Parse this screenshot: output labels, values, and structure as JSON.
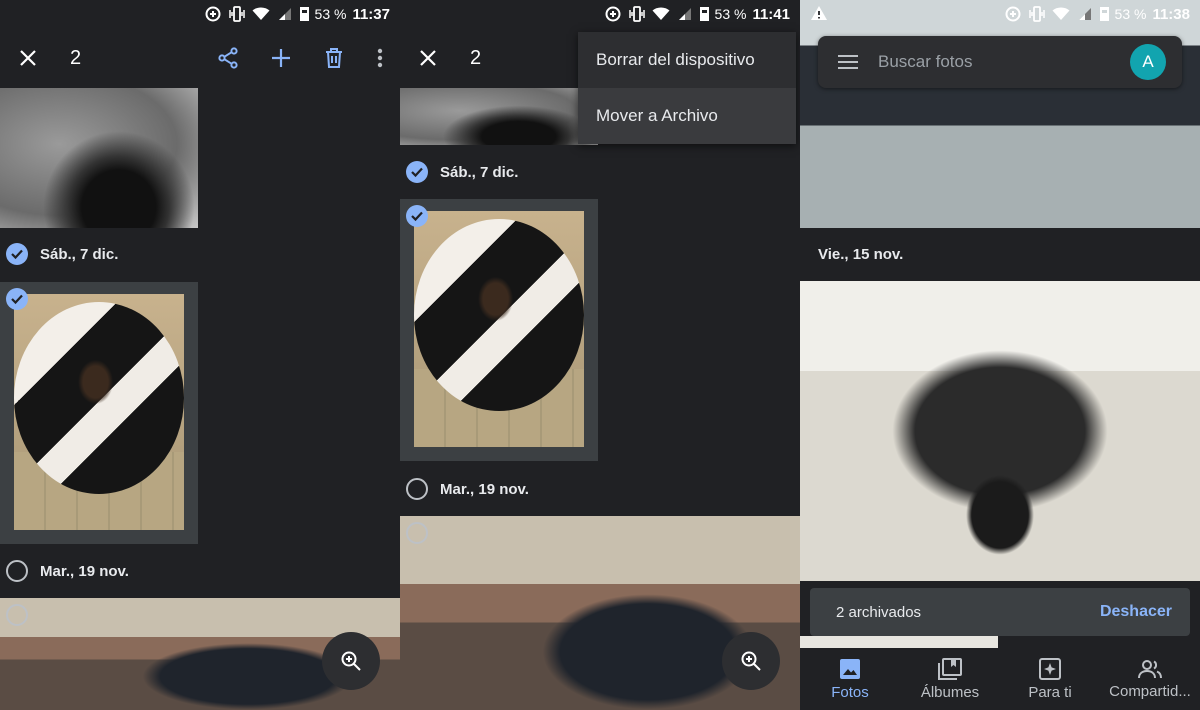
{
  "colors": {
    "background": "#202124",
    "accent": "#8ab4f8",
    "surface": "#2d2e31",
    "avatar": "#12a4af"
  },
  "panel1": {
    "status": {
      "battery": "53 %",
      "time": "11:37"
    },
    "appbar": {
      "selected_count": "2"
    },
    "groups": [
      {
        "date": "Sáb., 7 dic.",
        "checked": true
      },
      {
        "date": "Mar., 19 nov.",
        "checked": false
      }
    ]
  },
  "panel2": {
    "status": {
      "battery": "53 %",
      "time": "11:41"
    },
    "appbar": {
      "selected_count": "2"
    },
    "menu": {
      "items": [
        "Borrar del dispositivo",
        "Mover a Archivo"
      ]
    },
    "groups": [
      {
        "date": "Sáb., 7 dic.",
        "checked": true
      },
      {
        "date": "Mar., 19 nov.",
        "checked": false
      }
    ]
  },
  "panel3": {
    "status": {
      "battery": "53 %",
      "time": "11:38"
    },
    "search": {
      "placeholder": "Buscar fotos",
      "avatar_initial": "A"
    },
    "groups": [
      {
        "date": "Vie., 15 nov."
      }
    ],
    "snackbar": {
      "message": "2 archivados",
      "action": "Deshacer"
    },
    "nav": [
      {
        "label": "Fotos",
        "icon": "photo-icon",
        "active": true
      },
      {
        "label": "Álbumes",
        "icon": "album-icon",
        "active": false
      },
      {
        "label": "Para ti",
        "icon": "for-you-icon",
        "active": false
      },
      {
        "label": "Compartid...",
        "icon": "sharing-icon",
        "active": false
      }
    ]
  }
}
